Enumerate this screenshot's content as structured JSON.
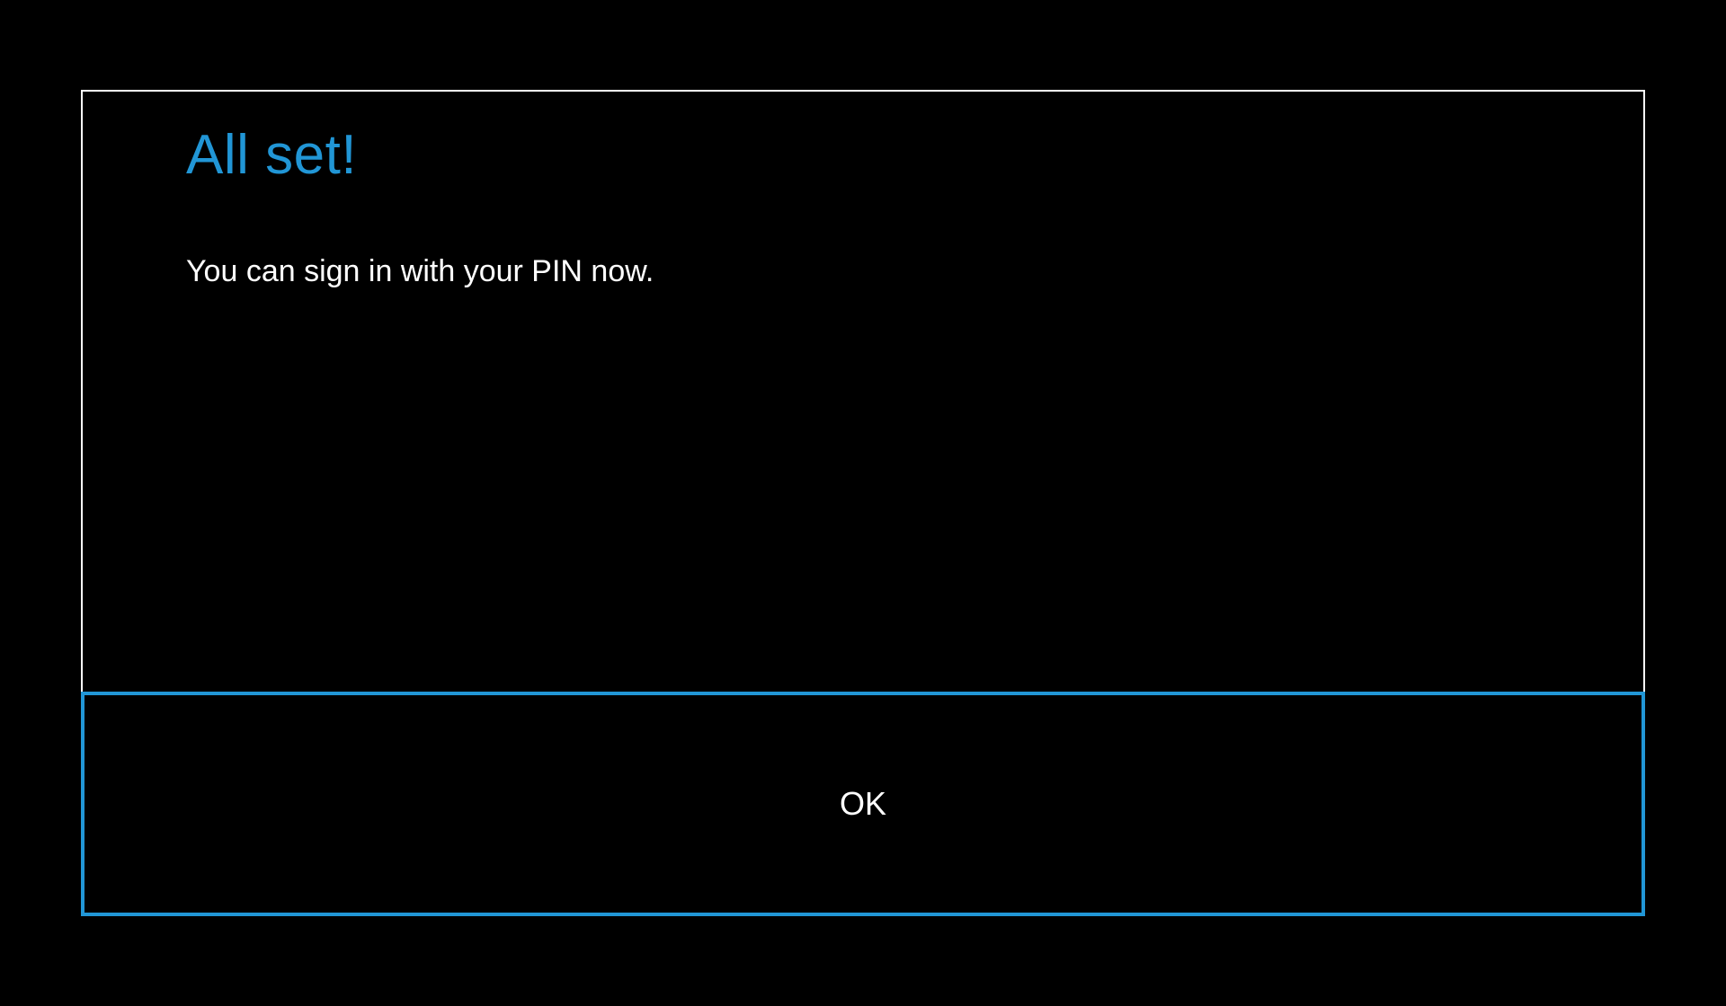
{
  "dialog": {
    "title": "All set!",
    "message": "You can sign in with your PIN now.",
    "button_label": "OK"
  },
  "colors": {
    "accent": "#2196d6",
    "background": "#000000",
    "text": "#ffffff",
    "border": "#ffffff"
  }
}
